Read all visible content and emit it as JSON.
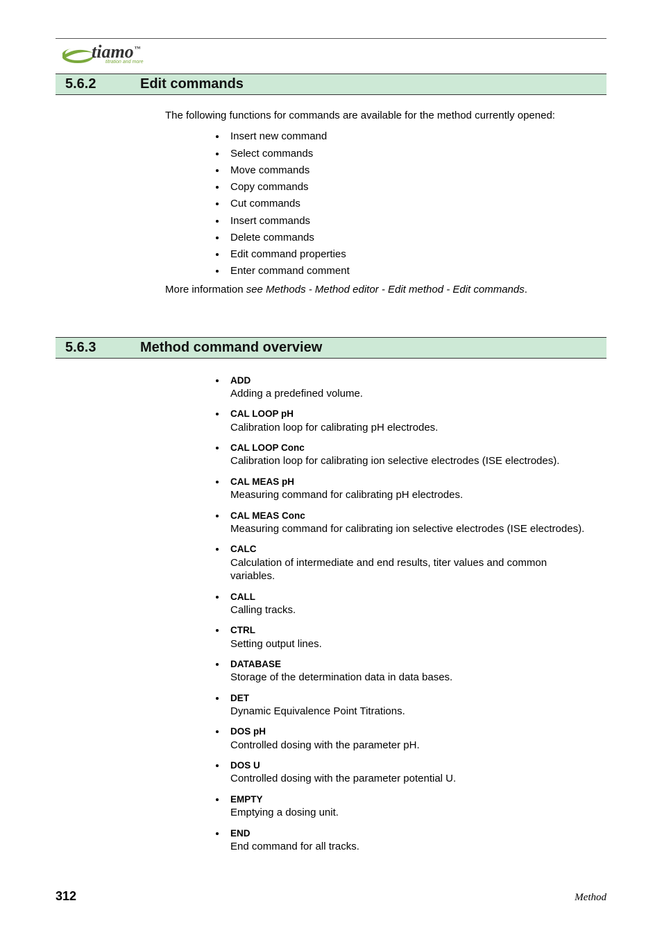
{
  "logo": {
    "brand": "tiamo",
    "tm": "™",
    "tag": "titration and more"
  },
  "section1": {
    "num": "5.6.2",
    "title": "Edit commands",
    "intro": "The following functions for commands are available for the method currently opened:",
    "items": [
      "Insert new command",
      "Select commands",
      "Move commands",
      "Copy commands",
      "Cut commands",
      "Insert commands",
      "Delete commands",
      "Edit command properties",
      "Enter command comment"
    ],
    "more_label": "More information ",
    "more_ref": "see Methods - Method editor - Edit method - Edit commands",
    "more_end": "."
  },
  "section2": {
    "num": "5.6.3",
    "title": "Method command overview",
    "defs": [
      {
        "term": "ADD",
        "desc": "Adding a predefined volume."
      },
      {
        "term": "CAL LOOP pH",
        "desc": "Calibration loop for calibrating pH electrodes."
      },
      {
        "term": "CAL LOOP Conc",
        "desc": "Calibration loop for calibrating ion selective electrodes (ISE electrodes)."
      },
      {
        "term": "CAL MEAS pH",
        "desc": "Measuring command for calibrating pH electrodes."
      },
      {
        "term": "CAL MEAS Conc",
        "desc": "Measuring command for calibrating ion selective electrodes (ISE electrodes)."
      },
      {
        "term": "CALC",
        "desc": "Calculation of intermediate and end results, titer values and common variables."
      },
      {
        "term": "CALL",
        "desc": "Calling tracks."
      },
      {
        "term": "CTRL",
        "desc": "Setting output lines."
      },
      {
        "term": "DATABASE",
        "desc": "Storage of the determination data in data bases."
      },
      {
        "term": "DET",
        "desc": "Dynamic Equivalence Point Titrations."
      },
      {
        "term": "DOS pH",
        "desc": "Controlled dosing with the parameter pH."
      },
      {
        "term": "DOS U",
        "desc": "Controlled dosing with the parameter potential U."
      },
      {
        "term": "EMPTY",
        "desc": "Emptying a dosing unit."
      },
      {
        "term": "END",
        "desc": "End command for all tracks."
      }
    ]
  },
  "footer": {
    "page": "312",
    "title": "Method"
  }
}
